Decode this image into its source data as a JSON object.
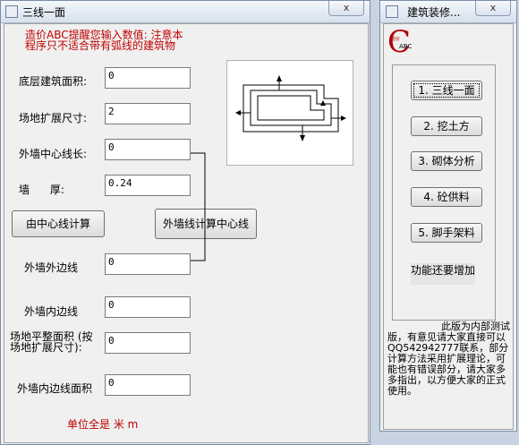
{
  "main_window": {
    "title": "三线一面",
    "close": "x",
    "notice": "造价ABC提醒您输入数值: 注意本程序只不适合带有弧线的建筑物",
    "fields": {
      "floor_area": {
        "label": "底层建筑面积:",
        "value": "0"
      },
      "site_extend": {
        "label": "场地扩展尺寸:",
        "value": "2"
      },
      "outer_center_len": {
        "label": "外墙中心线长:",
        "value": "0"
      },
      "wall_thickness": {
        "label": "墙      厚:",
        "value": "0.24"
      },
      "outer_edge_line": {
        "label": "外墙外边线",
        "value": "0"
      },
      "inner_edge_line": {
        "label": "外墙内边线",
        "value": "0"
      },
      "site_level_area": {
        "label": "场地平整面积 (按场地扩展尺寸):",
        "value": "0"
      },
      "inner_edge_area": {
        "label": "外墙内边线面积",
        "value": "0"
      }
    },
    "btn_calc_from_center": "由中心线计算",
    "btn_calc_center": "外墙线计算中心线",
    "unit_note": "单位全是 米 m"
  },
  "side_window": {
    "title": "建筑装修...",
    "close": "x",
    "logo_letter": "C",
    "logo_text": "ABC",
    "logo_small": "造价",
    "menu": [
      "1. 三线一面",
      "2. 挖土方",
      "3. 砌体分析",
      "4. 砼供料",
      "5. 脚手架料"
    ],
    "more": "功能还要增加",
    "note": "此版为内部测试版，有意见请大家直接可以QQ542942777联系，部分计算方法采用扩展理论，可能也有错误部分，请大家多多指出，以方便大家的正式使用。"
  },
  "colors": {
    "notice": "#c00000",
    "logo": "#b00000"
  }
}
